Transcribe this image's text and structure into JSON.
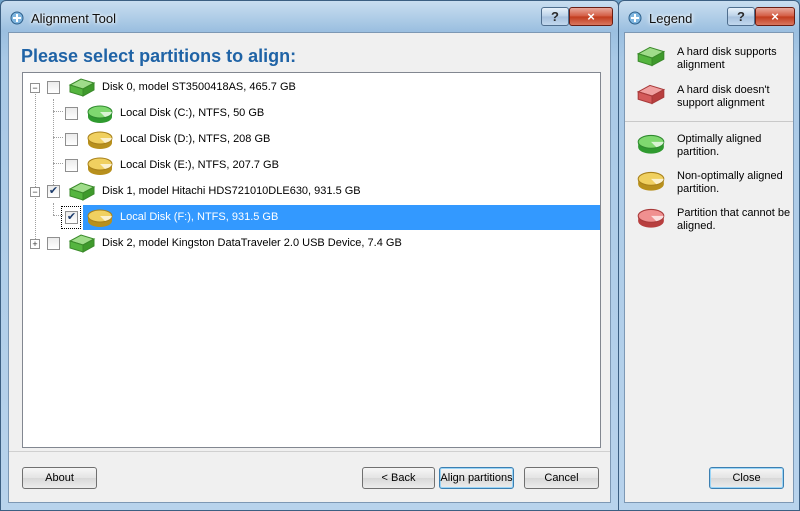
{
  "main_window": {
    "title": "Alignment Tool",
    "help_label": "?",
    "close_label": "×",
    "heading": "Please select partitions to align:",
    "tree": [
      {
        "label": "Disk 0, model ST3500418AS, 465.7 GB",
        "expander": "−",
        "checked": false,
        "icon": "hard-disk-icon"
      },
      {
        "label": "Local Disk (C:), NTFS, 50 GB",
        "checked": false,
        "icon": "green-partition-icon"
      },
      {
        "label": "Local Disk (D:), NTFS, 208 GB",
        "checked": false,
        "icon": "yellow-partition-icon"
      },
      {
        "label": "Local Disk (E:), NTFS, 207.7 GB",
        "checked": false,
        "icon": "yellow-partition-icon"
      },
      {
        "label": "Disk 1, model Hitachi HDS721010DLE630, 931.5 GB",
        "expander": "−",
        "checked": true,
        "check_glyph": "✔",
        "icon": "hard-disk-icon"
      },
      {
        "label": "Local Disk (F:), NTFS, 931.5 GB",
        "checked": true,
        "check_glyph": "✔",
        "selected": true,
        "icon": "yellow-partition-icon"
      },
      {
        "label": "Disk 2, model Kingston DataTraveler 2.0 USB Device, 7.4 GB",
        "expander": "+",
        "checked": false,
        "icon": "hard-disk-icon"
      }
    ],
    "buttons": {
      "about": "About",
      "back": "< Back",
      "align": "Align partitions",
      "cancel": "Cancel"
    }
  },
  "legend_window": {
    "title": "Legend",
    "help_label": "?",
    "close_label": "×",
    "items": [
      {
        "text": "A hard disk supports alignment",
        "icon": "green-hard-disk-icon"
      },
      {
        "text": "A hard disk doesn't support alignment",
        "icon": "red-hard-disk-icon"
      },
      {
        "text": "Optimally aligned partition.",
        "icon": "green-partition-icon"
      },
      {
        "text": "Non-optimally aligned partition.",
        "icon": "yellow-partition-icon"
      },
      {
        "text": "Partition that cannot be aligned.",
        "icon": "red-partition-icon"
      }
    ],
    "close_button": "Close"
  },
  "colors": {
    "heading": "#1f63a6",
    "selection": "#3399ff",
    "green": "#3fb23f",
    "yellow": "#d9b431",
    "red": "#d45a5a"
  }
}
